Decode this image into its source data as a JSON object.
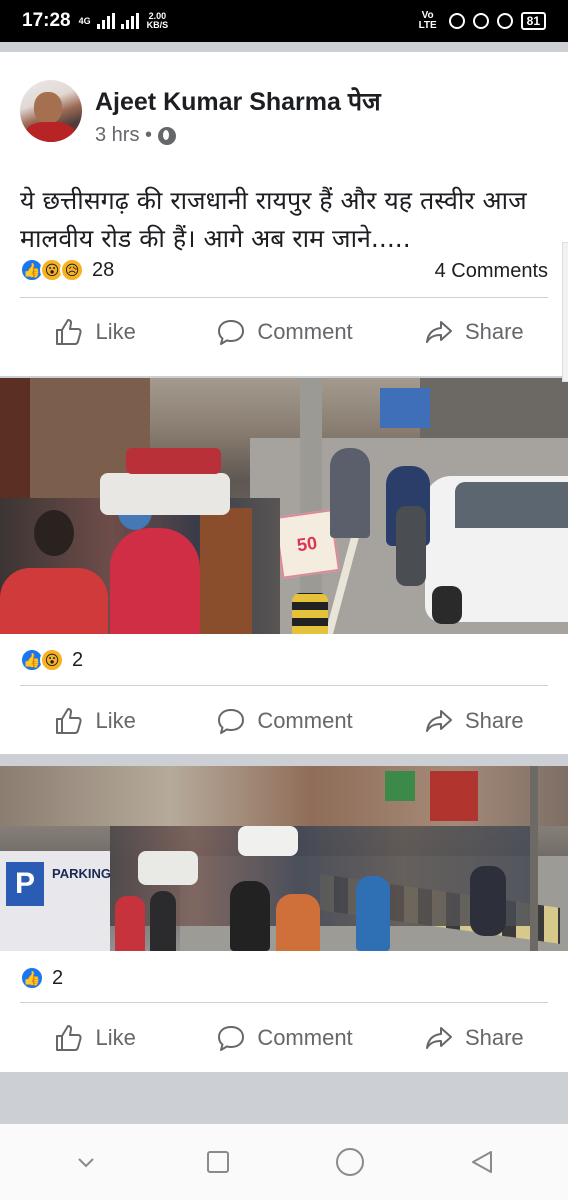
{
  "status_bar": {
    "time": "17:28",
    "network_type": "4G",
    "speed_value": "2.00",
    "speed_unit": "KB/S",
    "volte": "Vo LTE",
    "battery": "81"
  },
  "post": {
    "author": "Ajeet Kumar Sharma पेज",
    "time": "3 hrs •",
    "text": "ये छत्तीसगढ़ की राजधानी रायपुर हैं और यह तस्वीर आज मालवीय रोड की हैं। आगे अब राम जाने.....",
    "reaction_count": "28",
    "comments": "4 Comments",
    "reaction_icons": [
      "like-icon",
      "wow-icon",
      "sad-icon"
    ]
  },
  "actions": {
    "like": "Like",
    "comment": "Comment",
    "share": "Share"
  },
  "photos": [
    {
      "reaction_count": "2",
      "reaction_icons": [
        "like-icon",
        "wow-icon"
      ],
      "sign_text": "50"
    },
    {
      "reaction_count": "2",
      "reaction_icons": [
        "like-icon"
      ],
      "sign_text": "PARKING"
    }
  ],
  "colors": {
    "facebook_blue": "#1877f2",
    "text_primary": "#1c1e21",
    "text_secondary": "#65676b",
    "feed_background": "#ccd0d5"
  }
}
